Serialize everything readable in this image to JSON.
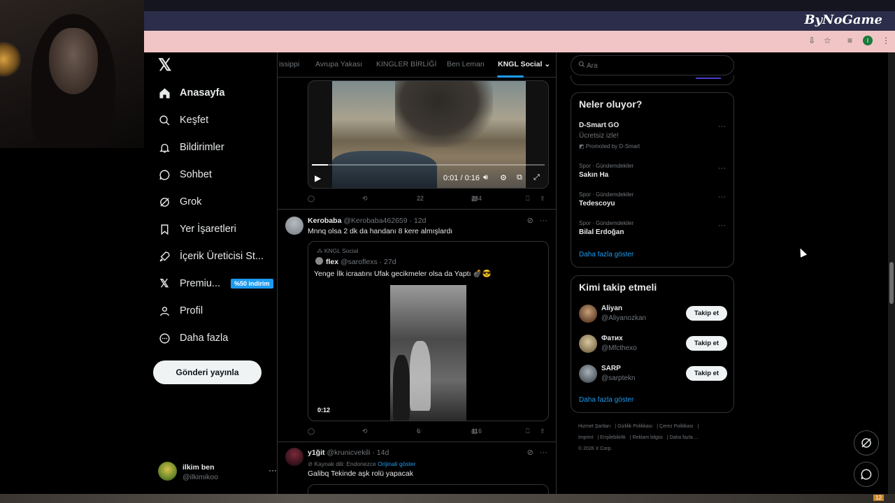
{
  "overlay": {
    "brand": "ByNoGame"
  },
  "nav": {
    "items": [
      {
        "label": "Anasayfa",
        "icon": "home-icon"
      },
      {
        "label": "Keşfet",
        "icon": "search-icon"
      },
      {
        "label": "Bildirimler",
        "icon": "bell-icon"
      },
      {
        "label": "Sohbet",
        "icon": "chat-icon"
      },
      {
        "label": "Grok",
        "icon": "grok-icon"
      },
      {
        "label": "Yer İşaretleri",
        "icon": "bookmark-icon"
      },
      {
        "label": "İçerik Üreticisi St...",
        "icon": "rocket-icon"
      },
      {
        "label": "Premiu...",
        "icon": "x-premium-icon",
        "badge": "%50 indirim"
      },
      {
        "label": "Profil",
        "icon": "person-icon"
      },
      {
        "label": "Daha fazla",
        "icon": "more-circle-icon"
      }
    ],
    "post_button": "Gönderi yayınla",
    "account": {
      "name": "ilkim ben",
      "handle": "@ilkimikoo"
    }
  },
  "tabs": [
    {
      "label": "issippi"
    },
    {
      "label": "Avrupa Yakası"
    },
    {
      "label": "KINGLER BİRLİĞİ"
    },
    {
      "label": "Ben Leman"
    },
    {
      "label": "KNGL Social",
      "active": true
    }
  ],
  "feed": {
    "video1": {
      "time": "0:01 / 0:16",
      "progress": 0.07,
      "replies": "",
      "reposts": "",
      "likes": "22",
      "views": "284"
    },
    "tweet2": {
      "name": "Kerobaba",
      "handle": "@Kerobaba462659",
      "age": "12d",
      "text": "Mnnq olsa 2 dk da handanı 8 kere almışlardı",
      "quote": {
        "community": "KNGL Social",
        "name": "flex",
        "handle": "@saroflexs",
        "age": "27d",
        "text": "Yenge İlk icraatını Ufak gecikmeler olsa da Yaptı 💣😎",
        "duration": "0:12"
      },
      "likes": "6",
      "views": "416"
    },
    "tweet3": {
      "name": "y1ğit",
      "handle": "@krunicvekili",
      "age": "14d",
      "source_lang": "Kaynak dili: Endonezce",
      "show_original": "Orijinali göster",
      "text": "Galibq Tekinde aşk rolü yapacak"
    }
  },
  "search": {
    "placeholder": "Ara"
  },
  "trends": {
    "title": "Neler oluyor?",
    "promoted": {
      "title": "D-Smart GO",
      "subtitle": "Ücretsiz izle!",
      "promo": "Promoted by D-Smart"
    },
    "items": [
      {
        "category": "Spor · Gündemdekiler",
        "title": "Sakın Ha"
      },
      {
        "category": "Spor · Gündemdekiler",
        "title": "Tedescoyu"
      },
      {
        "category": "Spor · Gündemdekiler",
        "title": "Bilal Erdoğan"
      }
    ],
    "show_more": "Daha fazla göster"
  },
  "who_to_follow": {
    "title": "Kimi takip etmeli",
    "users": [
      {
        "name": "Aliyan",
        "handle": "@Aliyanozkan",
        "button": "Takip et"
      },
      {
        "name": "Фатих",
        "handle": "@Mfcthexo",
        "button": "Takip et"
      },
      {
        "name": "SARP",
        "handle": "@sarptekn",
        "button": "Takip et"
      }
    ],
    "show_more": "Daha fazla göster"
  },
  "footer": {
    "links": [
      "Hizmet Şartları",
      "Gizlilik Politikası",
      "Çerez Politikası",
      "Imprint",
      "Erişilebilirlik",
      "Reklam bilgisi",
      "Daha fazla ..."
    ],
    "copyright": "© 2026 X Corp."
  },
  "colors": {
    "accent": "#1d9bf0",
    "background": "#000000",
    "border": "#2f3336",
    "muted": "#71767b"
  }
}
